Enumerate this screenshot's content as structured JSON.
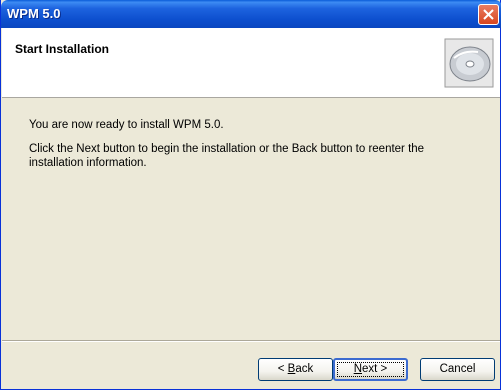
{
  "window": {
    "title": "WPM 5.0"
  },
  "header": {
    "title": "Start Installation",
    "icon": "cd-disc-icon"
  },
  "content": {
    "line1": "You are now ready to install WPM 5.0.",
    "line2": "Click the Next button to begin the installation or the Back button to reenter the installation information."
  },
  "buttons": {
    "back_accel": "B",
    "back_rest": "ack",
    "back_prefix": "< ",
    "next_accel": "N",
    "next_rest": "ext >",
    "cancel": "Cancel"
  },
  "colors": {
    "titlebar": "#0a47c0",
    "close": "#d8461f",
    "dialog_bg": "#ece9d8"
  }
}
